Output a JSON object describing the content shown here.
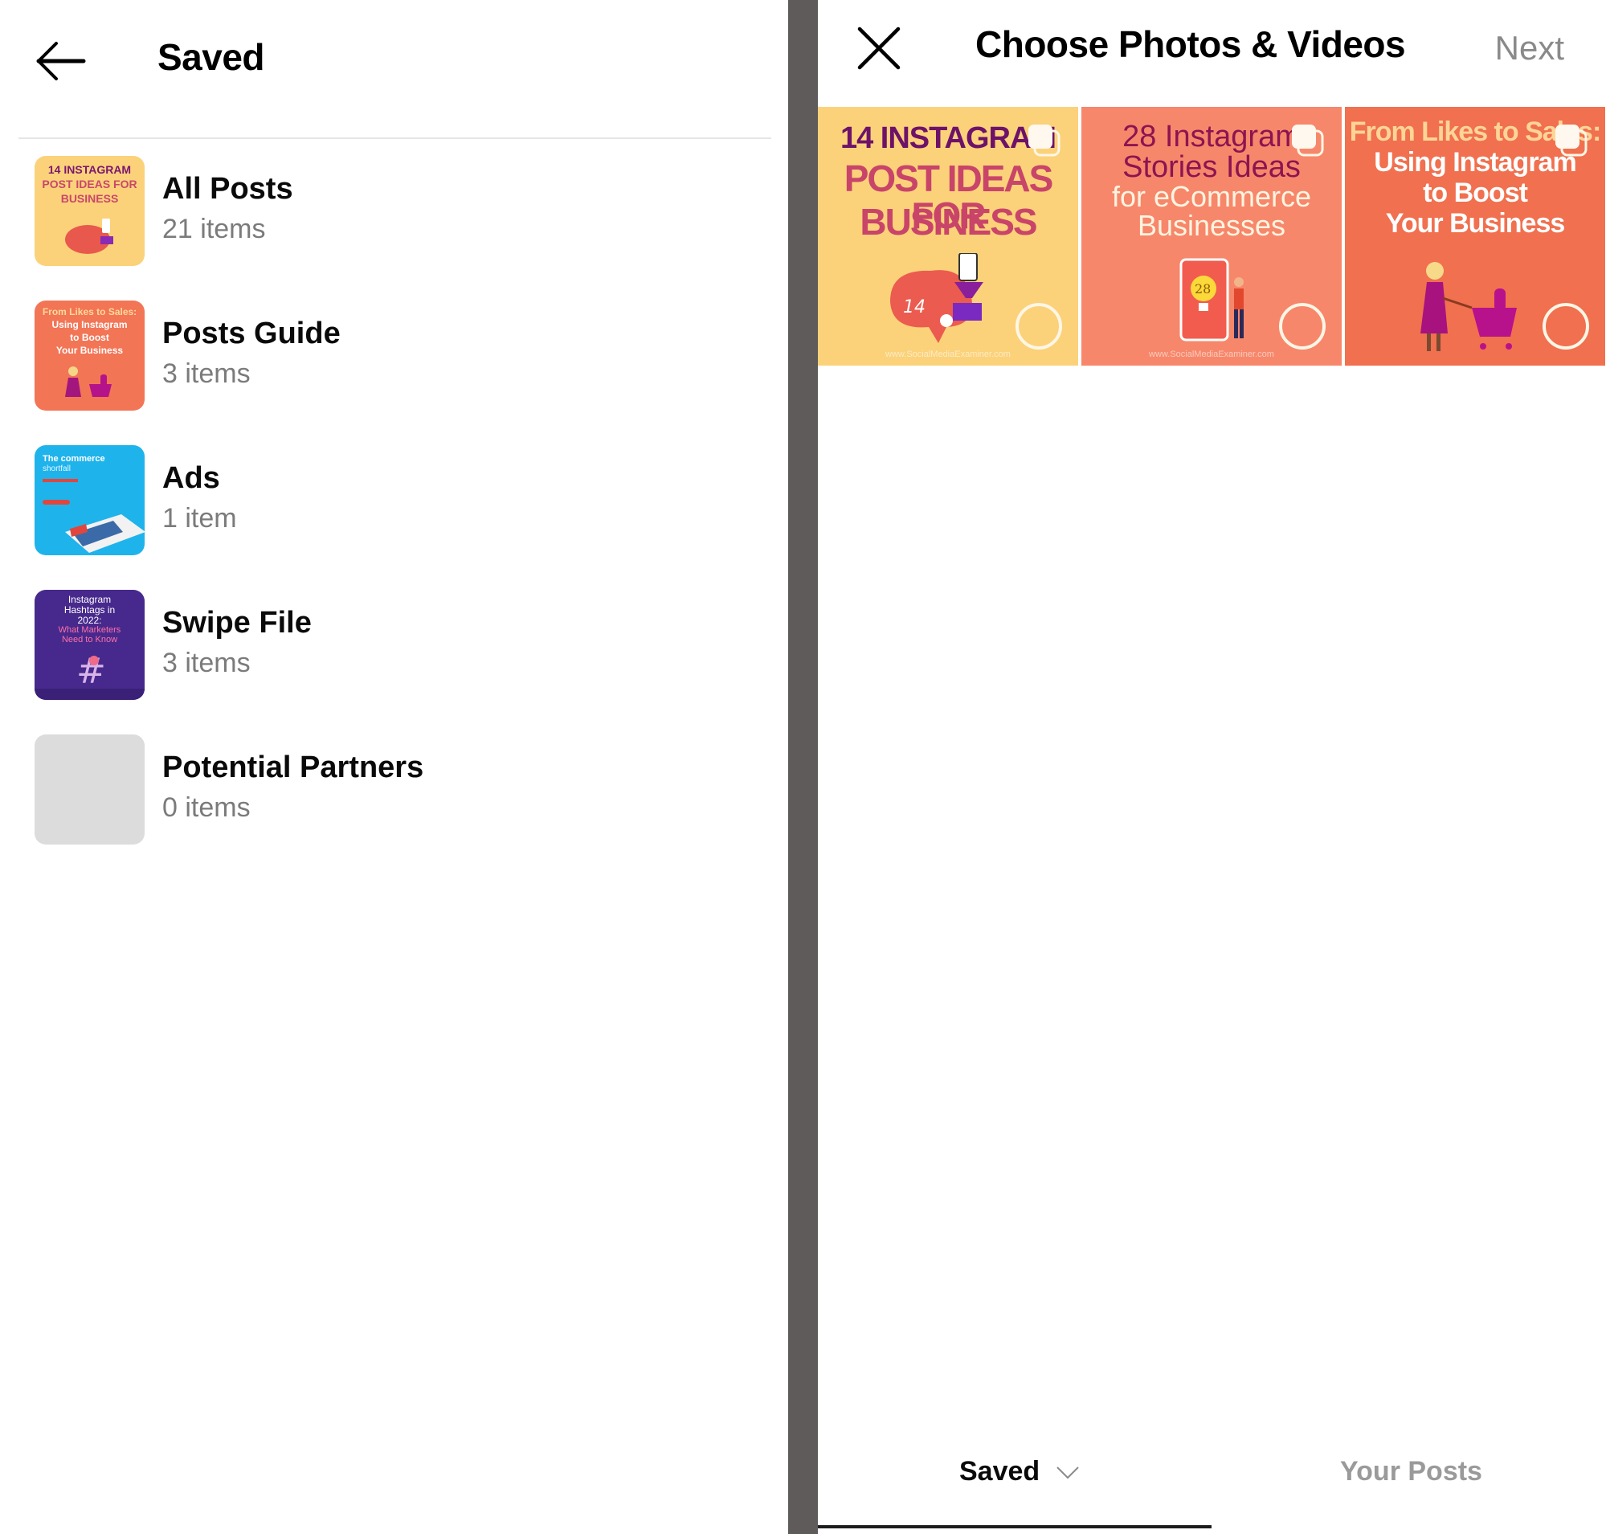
{
  "left_panel": {
    "title": "Saved",
    "back_icon": "arrow-left-icon",
    "collections": [
      {
        "name": "All Posts",
        "count": "21 items",
        "thumb": {
          "lines": [
            "14 INSTAGRAM",
            "POST IDEAS FOR",
            "BUSINESS"
          ],
          "color": "#fbd27a"
        }
      },
      {
        "name": "Posts Guide",
        "count": "3 items",
        "thumb": {
          "lines": [
            "From Likes to Sales:",
            "Using Instagram",
            "to Boost",
            "Your Business"
          ],
          "color": "#f27556"
        }
      },
      {
        "name": "Ads",
        "count": "1 item",
        "thumb": {
          "lines": [
            "The commerce",
            "shortfall"
          ],
          "color": "#1fb3ec"
        }
      },
      {
        "name": "Swipe File",
        "count": "3 items",
        "thumb": {
          "lines": [
            "Instagram",
            "Hashtags in",
            "2022:",
            "What Marketers",
            "Need to Know"
          ],
          "color": "#47298d"
        }
      },
      {
        "name": "Potential Partners",
        "count": "0 items",
        "thumb": {
          "lines": [],
          "color": "#dcdcdc"
        }
      }
    ]
  },
  "right_panel": {
    "title": "Choose Photos & Videos",
    "close_icon": "close-icon",
    "next_label": "Next",
    "media": [
      {
        "lines": [
          "14 INSTAGRAM",
          "POST IDEAS FOR",
          "BUSINESS"
        ],
        "watermark": "www.SocialMediaExaminer.com",
        "color": "#fbd27a",
        "multi": true,
        "selected": false
      },
      {
        "lines": [
          "28 Instagram",
          "Stories Ideas",
          "for eCommerce",
          "Businesses"
        ],
        "watermark": "www.SocialMediaExaminer.com",
        "color": "#f7876b",
        "multi": true,
        "selected": false
      },
      {
        "lines": [
          "From Likes to Sales:",
          "Using Instagram",
          "to Boost",
          "Your Business"
        ],
        "watermark": "",
        "color": "#f0704f",
        "multi": true,
        "selected": false
      }
    ],
    "tabs": [
      {
        "label": "Saved",
        "active": true,
        "has_dropdown": true
      },
      {
        "label": "Your Posts",
        "active": false,
        "has_dropdown": false
      }
    ]
  },
  "colors": {
    "divider": "#5f5b5b",
    "text_primary": "#0a0a0a",
    "text_secondary": "#7b7b7b",
    "next_inactive": "#8a8a8a"
  }
}
